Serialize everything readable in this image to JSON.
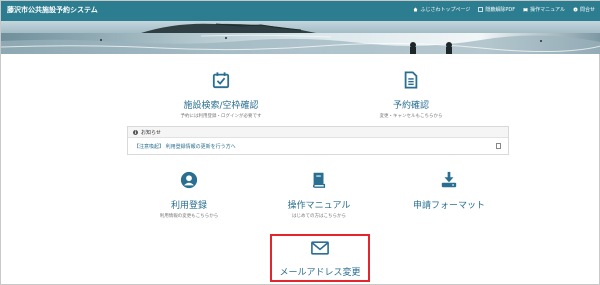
{
  "header": {
    "site_title": "藤沢市公共施設予約システム",
    "nav": [
      {
        "label": "ふじさわトップページ",
        "icon": "home-icon"
      },
      {
        "label": "隠蔽解除PDF",
        "icon": "document-icon"
      },
      {
        "label": "操作マニュアル",
        "icon": "book-icon"
      },
      {
        "label": "問合せ",
        "icon": "question-icon"
      }
    ]
  },
  "tiles": {
    "facility_search": {
      "title": "施設検索/空枠確認",
      "sub": "予約には利用登録・ログインが必要です",
      "icon": "calendar-check-icon"
    },
    "reservation_check": {
      "title": "予約確認",
      "sub": "変更・キャンセルもこちらから",
      "icon": "document-list-icon"
    },
    "user_registration": {
      "title": "利用登録",
      "sub": "利用情報の変更もこちらから",
      "icon": "user-icon"
    },
    "manual": {
      "title": "操作マニュアル",
      "sub": "はじめての方はこちらから",
      "icon": "book-icon"
    },
    "application_format": {
      "title": "申請フォーマット",
      "sub": "",
      "icon": "download-icon"
    },
    "email_change": {
      "title": "メールアドレス変更",
      "sub": "",
      "icon": "mail-icon"
    }
  },
  "notice": {
    "title": "お知らせ",
    "item": "【注意喚起】 利用登録情報の更新を行う方へ"
  },
  "colors": {
    "header": "#2d7d90",
    "link": "#2a6f92",
    "highlight": "#e3262d"
  }
}
